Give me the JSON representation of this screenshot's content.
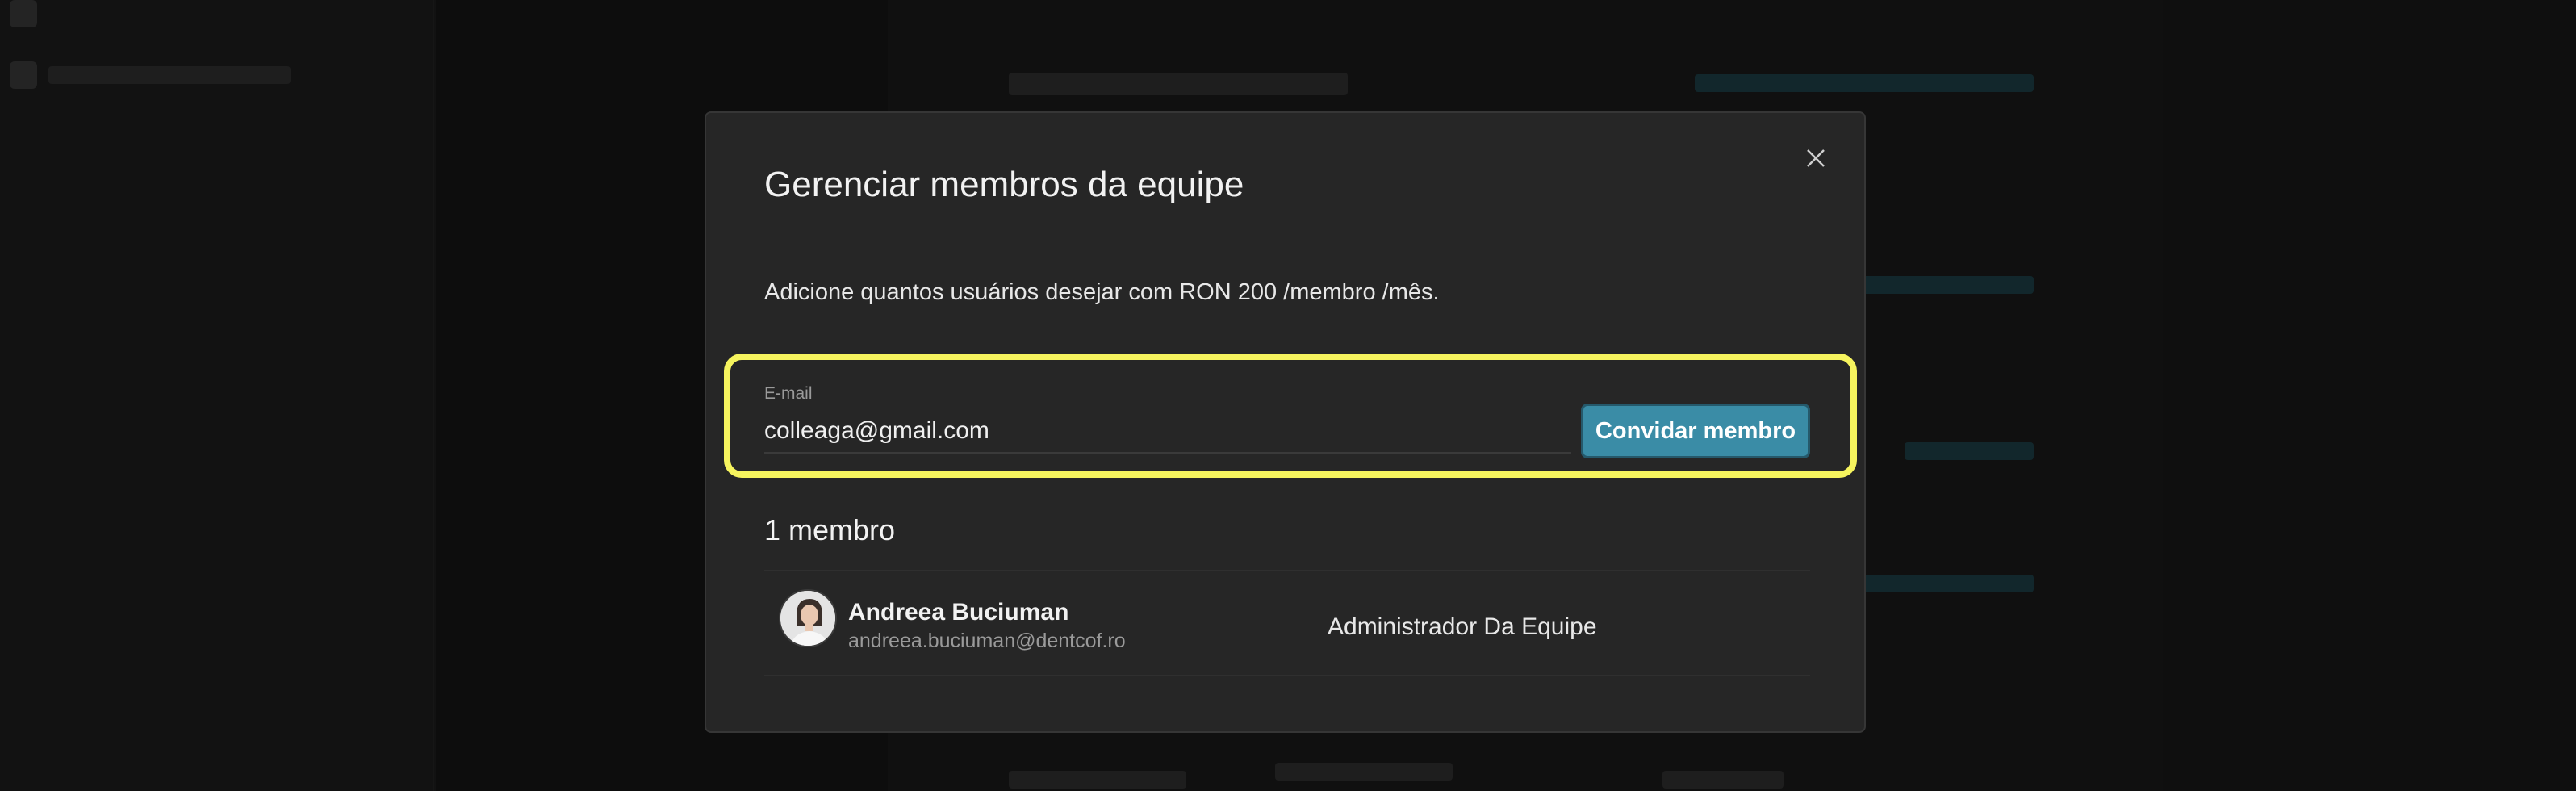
{
  "modal": {
    "title": "Gerenciar membros da equipe",
    "subtitle": "Adicione quantos usuários desejar com RON 200 /membro /mês.",
    "email_label": "E-mail",
    "email_value": "colleaga@gmail.com",
    "invite_label": "Convidar membro",
    "members_heading": "1 membro",
    "members": [
      {
        "name": "Andreea Buciuman",
        "email": "andreea.buciuman@dentcof.ro",
        "role": "Administrador Da Equipe"
      }
    ]
  },
  "colors": {
    "highlight": "#f6f45e",
    "accent": "#3a8ca6",
    "modal_bg": "#262626"
  },
  "icons": [
    "close-icon",
    "avatar-photo"
  ]
}
